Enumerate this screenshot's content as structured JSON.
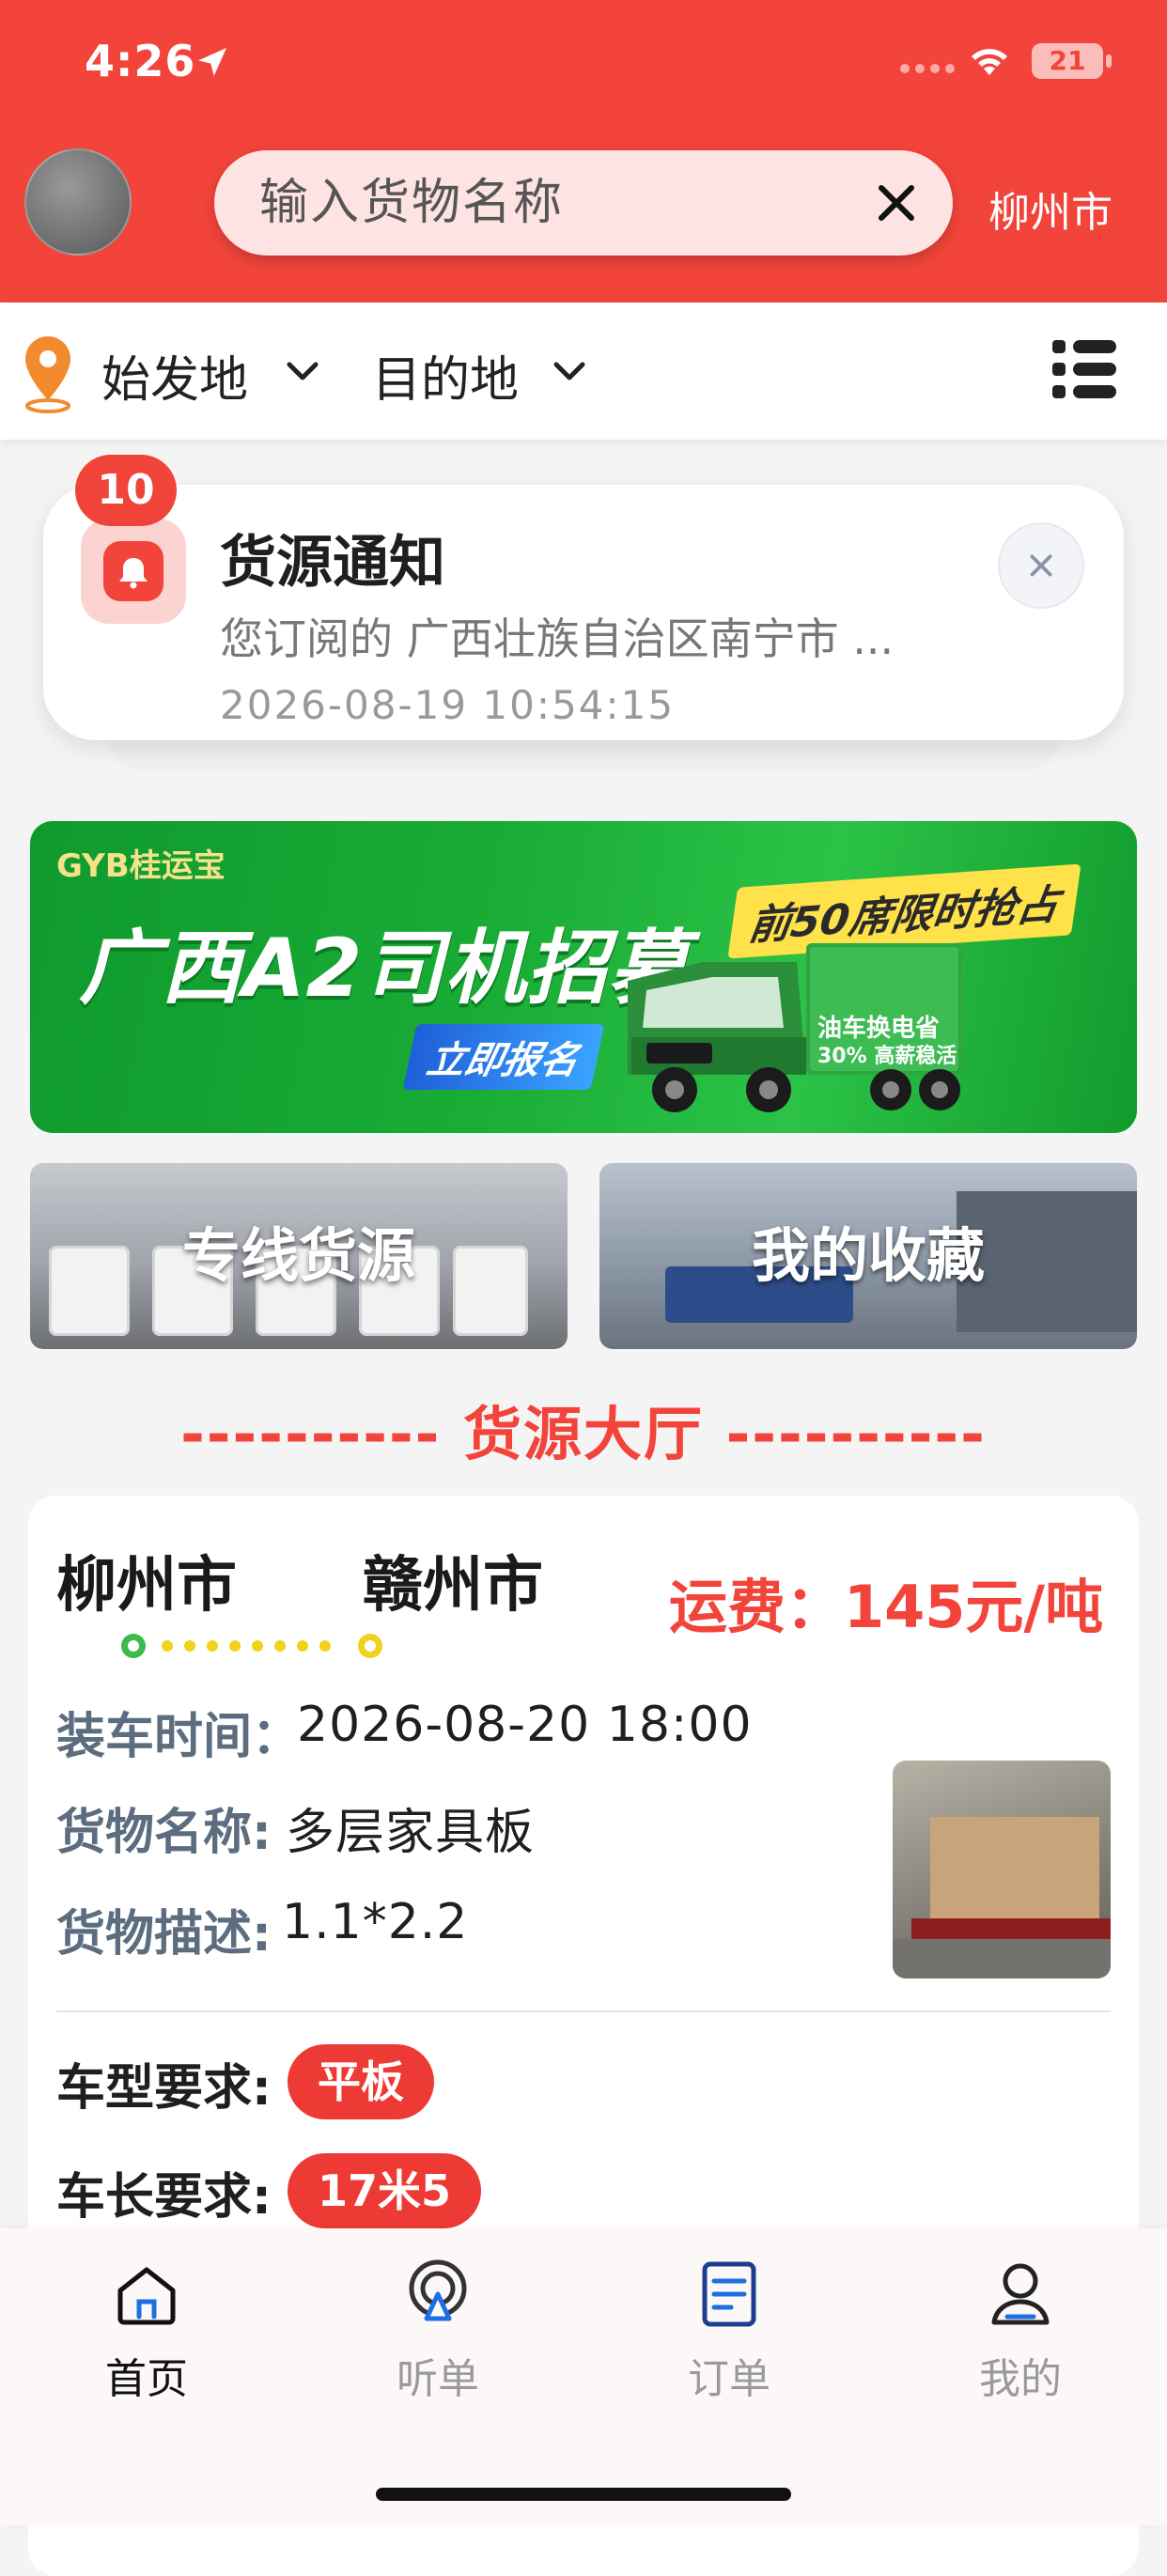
{
  "status_bar": {
    "time": "4:26",
    "battery": "21"
  },
  "header": {
    "search_placeholder": "输入货物名称",
    "city": "柳州市"
  },
  "filters": {
    "origin_label": "始发地",
    "destination_label": "目的地"
  },
  "notification": {
    "badge_count": "10",
    "title": "货源通知",
    "body": "您订阅的 广西壮族自治区南宁市 ...",
    "time": "2026-08-19 10:54:15"
  },
  "banner": {
    "logo": "GYB桂运宝",
    "headline": "广西A2司机招募",
    "cta": "立即报名",
    "tag": "前50席限时抢占",
    "truck_text_1": "油车换电省",
    "truck_text_2": "30% 高薪稳活"
  },
  "tiles": [
    {
      "label": "专线货源"
    },
    {
      "label": "我的收藏"
    }
  ],
  "section_title": "---------- 货源大厅 ----------",
  "cargo": {
    "from_city": "柳州市",
    "to_city": "赣州市",
    "price": "运费：145元/吨",
    "load_time_label": "装车时间：",
    "load_time": "2026-08-20 18:00",
    "goods_name_label": "货物名称:",
    "goods_name": "多层家具板",
    "goods_desc_label": "货物描述:",
    "goods_desc": "1.1*2.2",
    "vehicle_type_label": "车型要求:",
    "vehicle_type": "平板",
    "vehicle_length_label": "车长要求:",
    "vehicle_length": "17米5"
  },
  "tab_bar": {
    "tabs": [
      {
        "label": "首页",
        "icon": "home-icon",
        "active": true
      },
      {
        "label": "听单",
        "icon": "listen-order-icon",
        "active": false
      },
      {
        "label": "订单",
        "icon": "order-icon",
        "active": false
      },
      {
        "label": "我的",
        "icon": "profile-icon",
        "active": false
      }
    ]
  },
  "colors": {
    "brand_red": "#f2443a",
    "route_green": "#3dbb4a",
    "route_yellow": "#f2d21c"
  }
}
